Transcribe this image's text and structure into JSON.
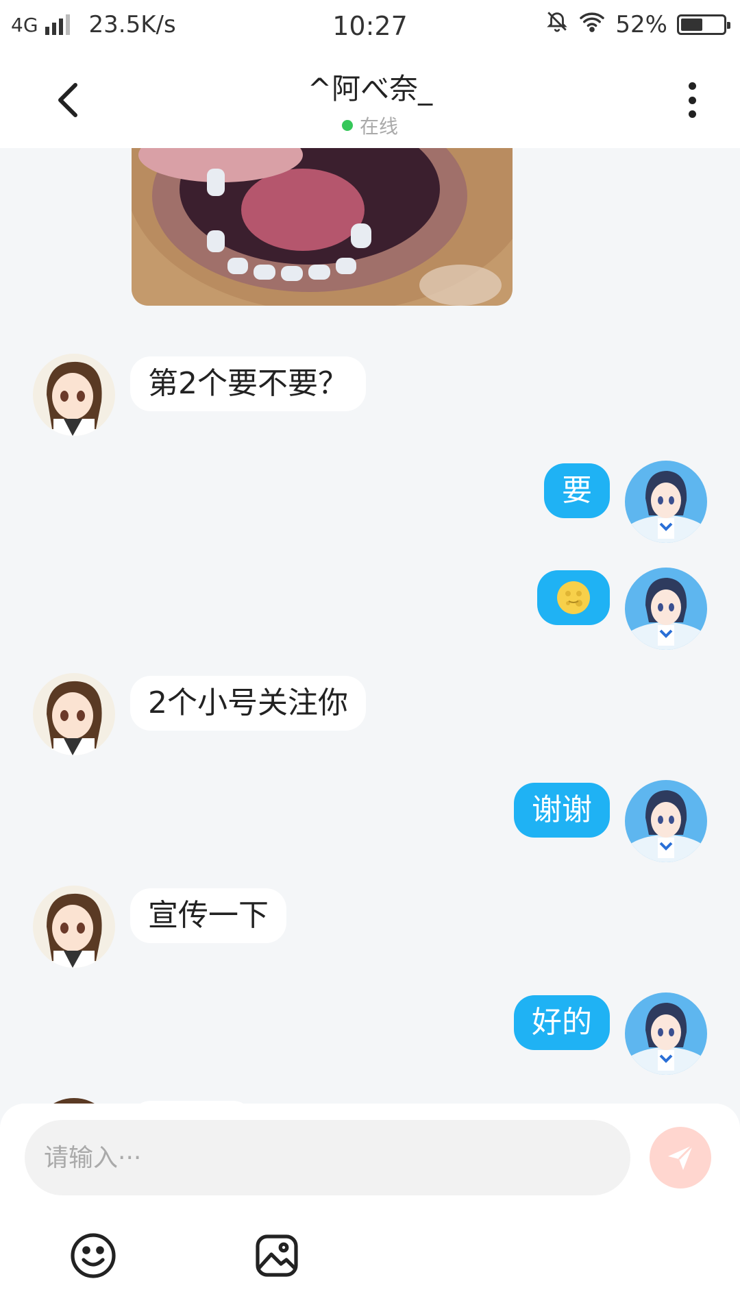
{
  "status_bar": {
    "network": "4G",
    "speed": "23.5K/s",
    "time": "10:27",
    "battery": "52%",
    "battery_level": 0.52
  },
  "header": {
    "title": "^阿べ奈_",
    "status": "在线",
    "status_color": "#35c759"
  },
  "messages": [
    {
      "side": "left",
      "text": "第2个要不要？"
    },
    {
      "side": "right",
      "text": "要"
    },
    {
      "side": "right",
      "emoji": "moon-face-emoji"
    },
    {
      "side": "left",
      "text": "2个小号关注你"
    },
    {
      "side": "right",
      "text": "谢谢"
    },
    {
      "side": "left",
      "text": "宣传一下"
    },
    {
      "side": "right",
      "text": "好的"
    }
  ],
  "input": {
    "placeholder": "请输入···"
  },
  "colors": {
    "sent_bubble": "#1fb2f4",
    "received_bubble": "#ffffff",
    "background": "#f4f6f8",
    "send_button": "#ffd6cf"
  },
  "icons": {
    "back": "chevron-left-icon",
    "more": "more-vertical-icon",
    "send": "send-icon",
    "emoji": "smiley-icon",
    "image": "image-icon"
  }
}
